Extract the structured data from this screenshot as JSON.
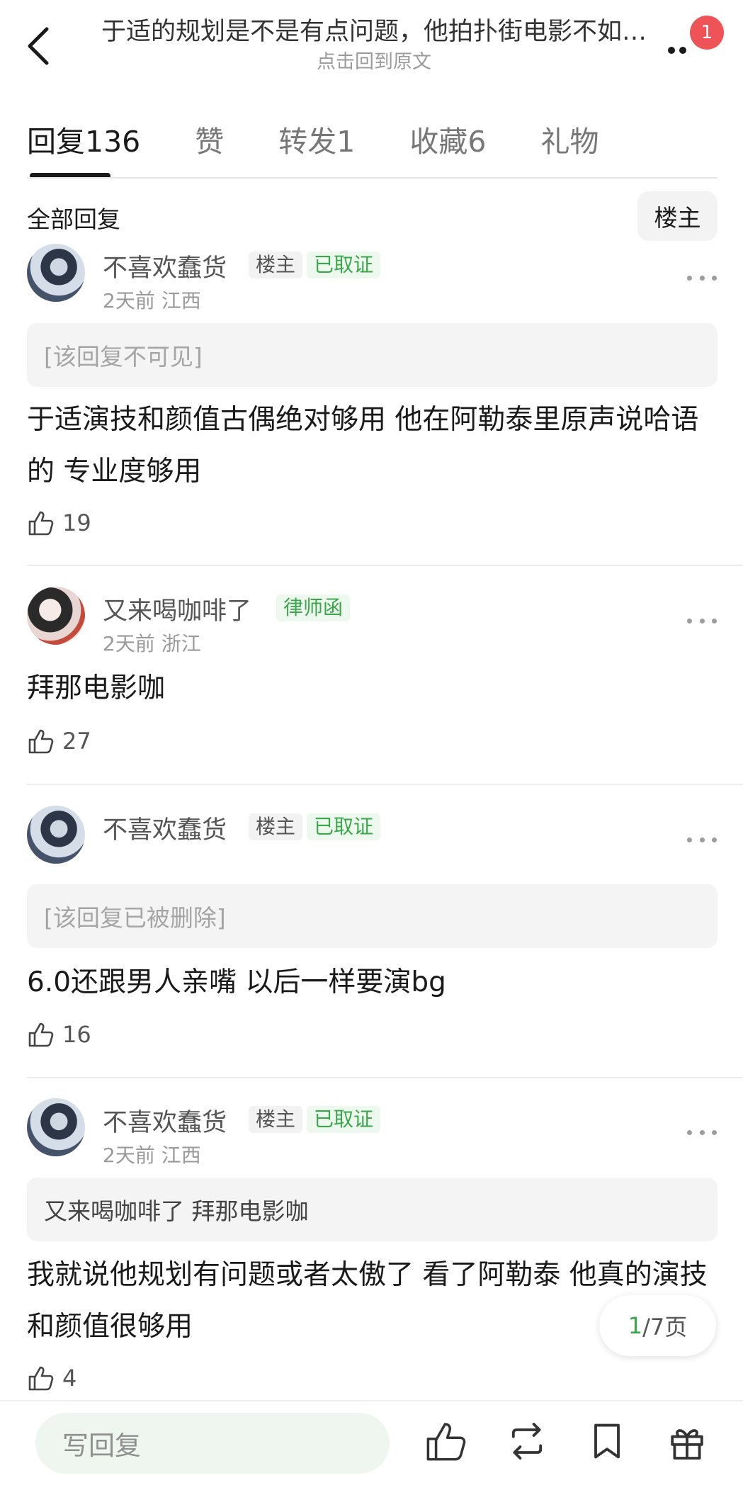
{
  "header": {
    "title": "于适的规划是不是有点问题，他拍扑街电影不如…",
    "back_hint": "点击回到原文",
    "notification_count": "1"
  },
  "tabs": [
    {
      "label": "回复",
      "count": "136",
      "active": true
    },
    {
      "label": "赞",
      "count": "",
      "active": false
    },
    {
      "label": "转发",
      "count": "1",
      "active": false
    },
    {
      "label": "收藏",
      "count": "6",
      "active": false
    },
    {
      "label": "礼物",
      "count": "",
      "active": false
    }
  ],
  "filter": {
    "label": "全部回复",
    "op_filter": "楼主"
  },
  "comments": [
    {
      "username": "不喜欢蠢货",
      "badge_op": "楼主",
      "badge_green": "已取证",
      "time": "2天前",
      "location": "江西",
      "quote": "[该回复不可见]",
      "body": "于适演技和颜值古偶绝对够用 他在阿勒泰里原声说哈语的 专业度够用",
      "likes": "19"
    },
    {
      "username": "又来喝咖啡了",
      "badge_green": "律师函",
      "time": "2天前",
      "location": "浙江",
      "body": "拜那电影咖",
      "likes": "27"
    },
    {
      "username": "不喜欢蠢货",
      "badge_op": "楼主",
      "badge_green": "已取证",
      "quote": "[该回复已被删除]",
      "body": "6.0还跟男人亲嘴 以后一样要演bg",
      "likes": "16"
    },
    {
      "username": "不喜欢蠢货",
      "badge_op": "楼主",
      "badge_green": "已取证",
      "time": "2天前",
      "location": "江西",
      "quote_user": "又来喝咖啡了",
      "quote_text": "拜那电影咖",
      "body": "我就说他规划有问题或者太傲了 看了阿勒泰 他真的演技和颜值很够用",
      "likes": "4"
    }
  ],
  "pagination": {
    "current": "1",
    "total_text": "/7页"
  },
  "bottom_bar": {
    "reply_placeholder": "写回复"
  },
  "colors": {
    "accent_green": "#3ba74a",
    "badge_red": "#ee5457",
    "input_bg": "#eef6ef"
  }
}
